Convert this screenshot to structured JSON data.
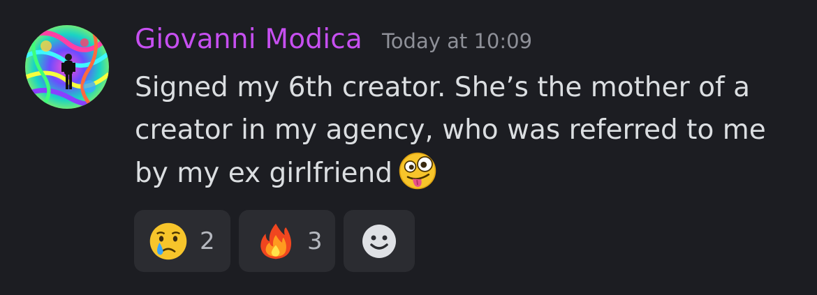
{
  "message": {
    "author": "Giovanni Modica",
    "timestamp": "Today at 10:09",
    "author_color": "#c64ff0",
    "lines": [
      "Signed my 6th creator.  She’s the mother of a",
      "creator in my agency, who was referred to me",
      "by my ex girlfriend"
    ],
    "inline_emoji": "zany-face-emoji"
  },
  "reactions": [
    {
      "emoji": "crying-face-emoji",
      "count": "2"
    },
    {
      "emoji": "fire-emoji",
      "count": "3"
    }
  ],
  "add_reaction": {
    "icon": "smiley-add-reaction-icon"
  }
}
